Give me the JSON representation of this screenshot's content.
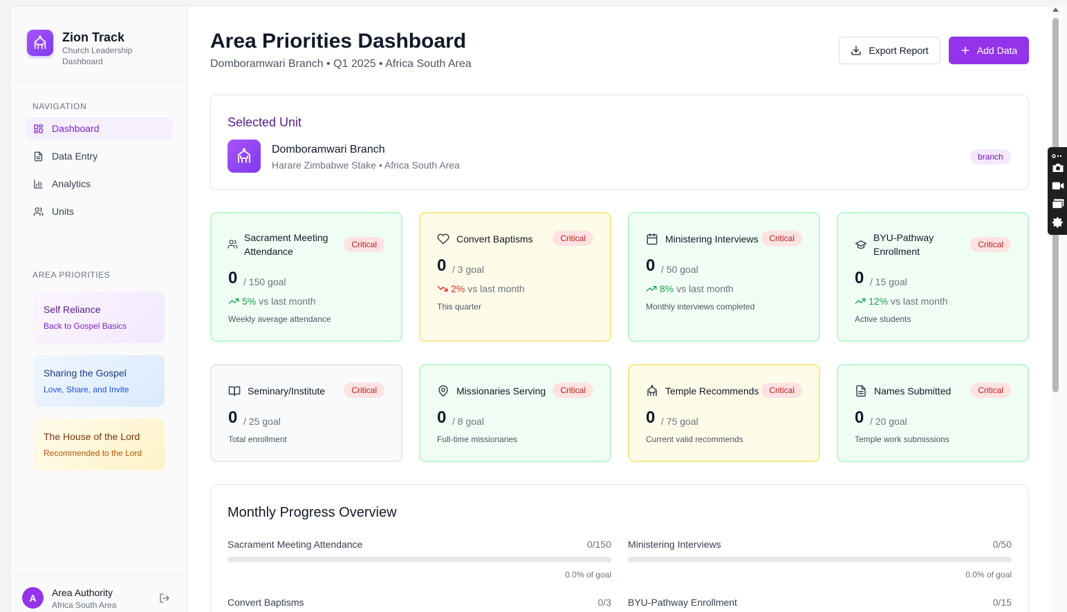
{
  "brand": {
    "name": "Zion Track",
    "subtitle": "Church Leadership Dashboard"
  },
  "sidebar": {
    "nav_label": "NAVIGATION",
    "nav_items": [
      {
        "label": "Dashboard",
        "icon": "grid-icon",
        "active": true
      },
      {
        "label": "Data Entry",
        "icon": "document-icon",
        "active": false
      },
      {
        "label": "Analytics",
        "icon": "bar-chart-icon",
        "active": false
      },
      {
        "label": "Units",
        "icon": "users-icon",
        "active": false
      }
    ],
    "priorities_label": "AREA PRIORITIES",
    "priorities": [
      {
        "title": "Self Reliance",
        "subtitle": "Back to Gospel Basics"
      },
      {
        "title": "Sharing the Gospel",
        "subtitle": "Love, Share, and Invite"
      },
      {
        "title": "The House of the Lord",
        "subtitle": "Recommended to the Lord"
      }
    ],
    "user": {
      "initial": "A",
      "name": "Area Authority",
      "area": "Africa South Area"
    }
  },
  "header": {
    "title": "Area Priorities Dashboard",
    "subtitle": "Domboramwari Branch • Q1 2025 • Africa South Area",
    "export_label": "Export Report",
    "add_label": "Add Data"
  },
  "selected_unit": {
    "heading": "Selected Unit",
    "name": "Domboramwari Branch",
    "meta": "Harare Zimbabwe Stake • Africa South Area",
    "badge": "branch"
  },
  "metrics": [
    {
      "title": "Sacrament Meeting Attendance",
      "icon": "users-icon",
      "status": "Critical",
      "value": "0",
      "goal": "/ 150 goal",
      "trend_dir": "up",
      "trend_pct": "5%",
      "trend_text": "vs last month",
      "desc": "Weekly average attendance",
      "color": "green"
    },
    {
      "title": "Convert Baptisms",
      "icon": "heart-icon",
      "status": "Critical",
      "value": "0",
      "goal": "/ 3 goal",
      "trend_dir": "down",
      "trend_pct": "2%",
      "trend_text": "vs last month",
      "desc": "This quarter",
      "color": "yellow"
    },
    {
      "title": "Ministering Interviews",
      "icon": "calendar-icon",
      "status": "Critical",
      "value": "0",
      "goal": "/ 50 goal",
      "trend_dir": "up",
      "trend_pct": "8%",
      "trend_text": "vs last month",
      "desc": "Monthly interviews completed",
      "color": "green"
    },
    {
      "title": "BYU-Pathway Enrollment",
      "icon": "graduation-cap-icon",
      "status": "Critical",
      "value": "0",
      "goal": "/ 15 goal",
      "trend_dir": "up",
      "trend_pct": "12%",
      "trend_text": "vs last month",
      "desc": "Active students",
      "color": "green"
    },
    {
      "title": "Seminary/Institute",
      "icon": "book-icon",
      "status": "Critical",
      "value": "0",
      "goal": "/ 25 goal",
      "desc": "Total enrollment",
      "color": "gray"
    },
    {
      "title": "Missionaries Serving",
      "icon": "map-pin-icon",
      "status": "Critical",
      "value": "0",
      "goal": "/ 8 goal",
      "desc": "Full-time missionaries",
      "color": "green"
    },
    {
      "title": "Temple Recommends",
      "icon": "temple-icon",
      "status": "Critical",
      "value": "0",
      "goal": "/ 75 goal",
      "desc": "Current valid recommends",
      "color": "yellow"
    },
    {
      "title": "Names Submitted",
      "icon": "file-text-icon",
      "status": "Critical",
      "value": "0",
      "goal": "/ 20 goal",
      "desc": "Temple work submissions",
      "color": "green"
    }
  ],
  "progress": {
    "title": "Monthly Progress Overview",
    "items": [
      {
        "label": "Sacrament Meeting Attendance",
        "value": "0/150",
        "pct_text": "0.0% of goal",
        "fraction": 0
      },
      {
        "label": "Ministering Interviews",
        "value": "0/50",
        "pct_text": "0.0% of goal",
        "fraction": 0
      },
      {
        "label": "Convert Baptisms",
        "value": "0/3",
        "pct_text": "",
        "fraction": 0
      },
      {
        "label": "BYU-Pathway Enrollment",
        "value": "0/15",
        "pct_text": "",
        "fraction": 0
      }
    ]
  }
}
